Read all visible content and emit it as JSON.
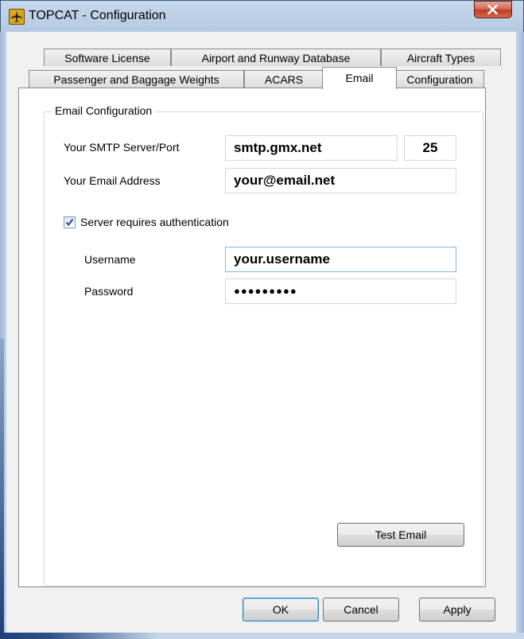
{
  "window": {
    "title": "TOPCAT - Configuration",
    "icon": "airplane-icon",
    "close_icon": "close-icon"
  },
  "tabs": {
    "row1": [
      "Software License",
      "Airport and Runway Database",
      "Aircraft Types"
    ],
    "row2": [
      "Passenger and Baggage Weights",
      "ACARS",
      "Email",
      "Configuration"
    ],
    "active": "Email"
  },
  "email": {
    "group_title": "Email Configuration",
    "smtp_label": "Your SMTP Server/Port",
    "smtp_server": "smtp.gmx.net",
    "smtp_port": "25",
    "address_label": "Your Email Address",
    "address": "your@email.net",
    "auth_label": "Server requires authentication",
    "auth_checked": true,
    "username_label": "Username",
    "username": "your.username",
    "password_label": "Password",
    "password_mask": "●●●●●●●●●",
    "test_button": "Test Email"
  },
  "buttons": {
    "ok": "OK",
    "cancel": "Cancel",
    "apply": "Apply"
  },
  "colors": {
    "title_bar": "#b4c9e2",
    "close_button": "#c23a24",
    "focus_border": "#7eb4ea"
  }
}
